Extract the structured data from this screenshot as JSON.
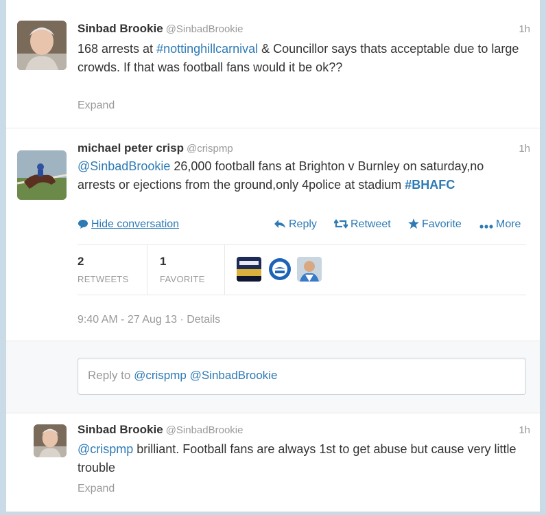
{
  "tweets": [
    {
      "name": "Sinbad Brookie",
      "handle": "@SinbadBrookie",
      "time": "1h",
      "text_before": "168 arrests at ",
      "hashtag": "#nottinghillcarnival",
      "text_after": " & Councillor says thats acceptable due to large crowds. If that was football fans would it be ok??",
      "expand": "Expand"
    },
    {
      "name": "michael peter crisp",
      "handle": "@crispmp",
      "time": "1h",
      "mention": "@SinbadBrookie",
      "text_mid": " 26,000 football fans at Brighton v Burnley on saturday,no arrests or ejections from the ground,only 4police at stadium ",
      "hashtag": "#BHAFC",
      "hide_conversation": "Hide conversation",
      "reply": "Reply",
      "retweet": "Retweet",
      "favorite": "Favorite",
      "more": "More",
      "retweets_count": "2",
      "retweets_label": "RETWEETS",
      "favorites_count": "1",
      "favorites_label": "FAVORITE",
      "timestamp": "9:40 AM - 27 Aug 13",
      "details": "Details"
    },
    {
      "name": "Sinbad Brookie",
      "handle": "@SinbadBrookie",
      "time": "1h",
      "mention": "@crispmp",
      "text_after": " brilliant. Football fans are always 1st to get abuse but cause very little trouble",
      "expand": "Expand"
    }
  ],
  "reply_box": {
    "prefix": "Reply to ",
    "mentions": "@crispmp @SinbadBrookie"
  },
  "colors": {
    "link": "#2d7ab5",
    "muted": "#999999",
    "text": "#333333"
  }
}
